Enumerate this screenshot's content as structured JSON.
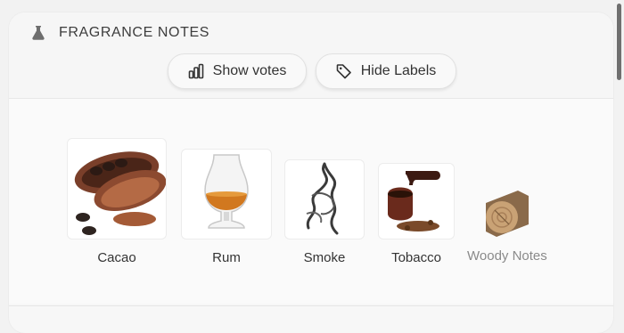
{
  "section": {
    "title": "FRAGRANCE NOTES"
  },
  "toolbar": {
    "votes_label": "Show votes",
    "labels_label": "Hide Labels"
  },
  "notes": [
    {
      "label": "Cacao",
      "image": "cacao-pod"
    },
    {
      "label": "Rum",
      "image": "rum-glass"
    },
    {
      "label": "Smoke",
      "image": "smoke-wisp"
    },
    {
      "label": "Tobacco",
      "image": "tobacco-pipe"
    },
    {
      "label": "Woody Notes",
      "image": "wood-log",
      "muted": true
    }
  ],
  "colors": {
    "accent_text": "#333333",
    "muted_text": "#8a8a8a"
  }
}
